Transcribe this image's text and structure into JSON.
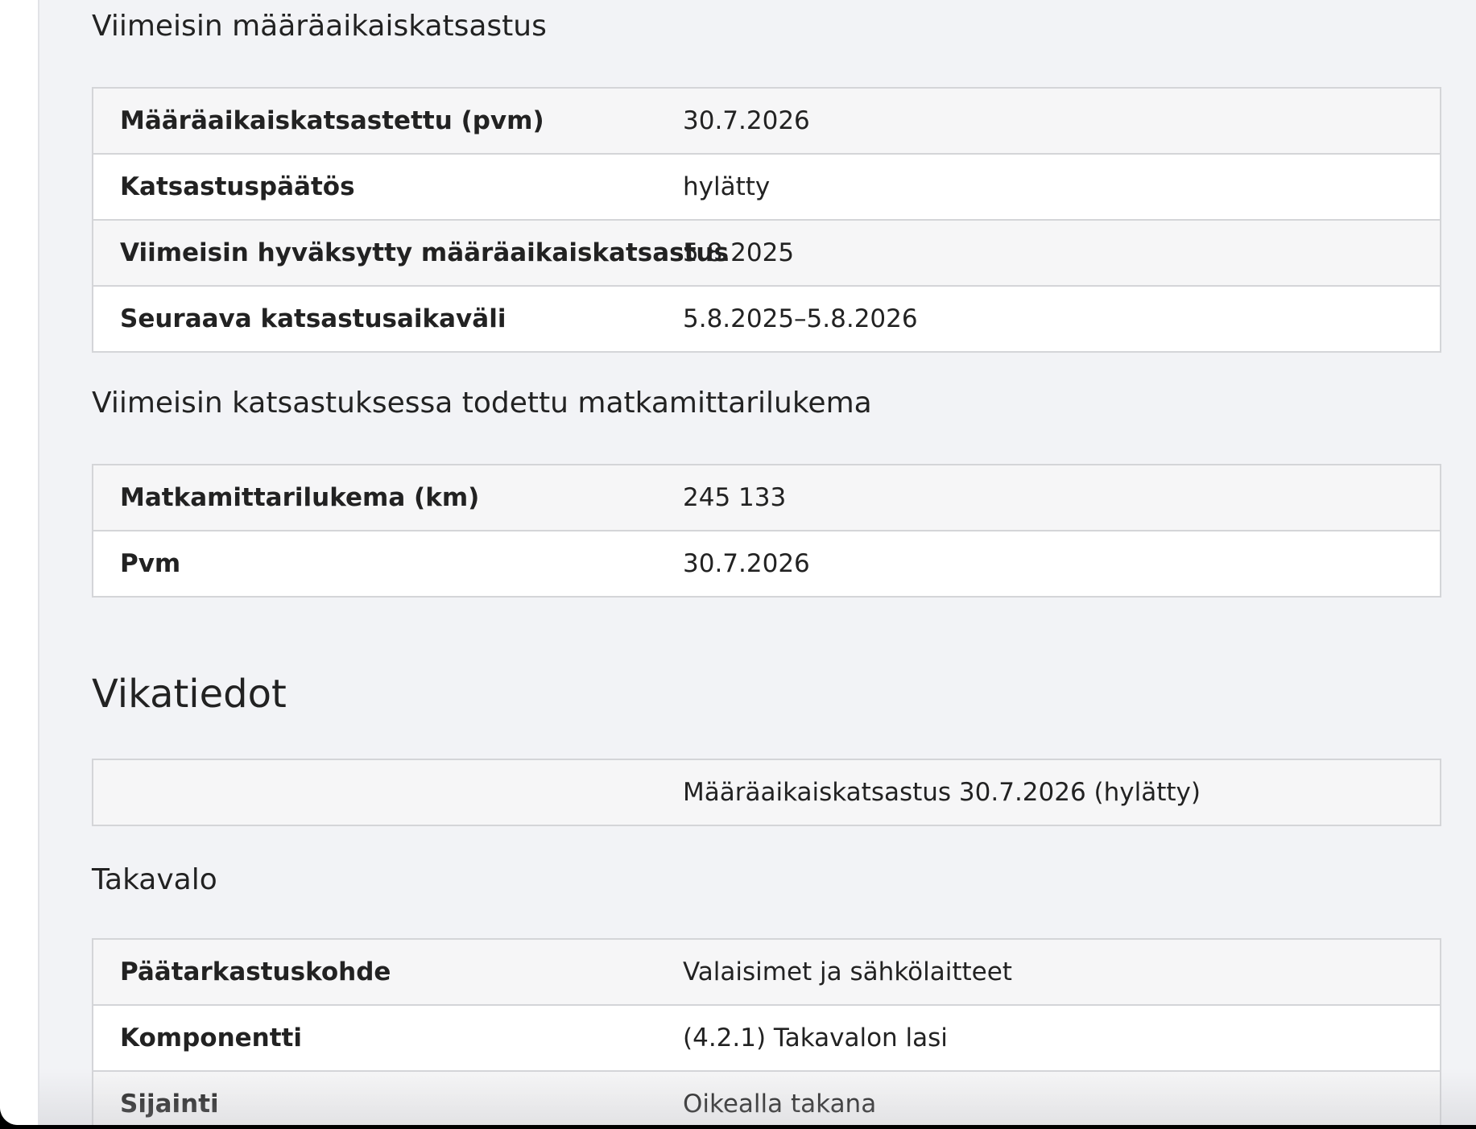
{
  "sections": {
    "inspection": {
      "title": "Viimeisin määräaikaiskatsastus",
      "rows": [
        {
          "label": "Määräaikaiskatsastettu (pvm)",
          "value": "30.7.2026"
        },
        {
          "label": "Katsastuspäätös",
          "value": "hylätty"
        },
        {
          "label": "Viimeisin hyväksytty määräaikaiskatsastus",
          "value": "5.8.2025"
        },
        {
          "label": "Seuraava katsastusaikaväli",
          "value": "5.8.2025–5.8.2026"
        }
      ]
    },
    "odometer": {
      "title": "Viimeisin katsastuksessa todettu matkamittarilukema",
      "rows": [
        {
          "label": "Matkamittarilukema (km)",
          "value": "245 133"
        },
        {
          "label": "Pvm",
          "value": "30.7.2026"
        }
      ]
    },
    "faults": {
      "title": "Vikatiedot",
      "summary_row": {
        "label": "",
        "value": "Määräaikaiskatsastus 30.7.2026 (hylätty)"
      },
      "item_title": "Takavalo",
      "rows": [
        {
          "label": "Päätarkastuskohde",
          "value": "Valaisimet ja sähkölaitteet"
        },
        {
          "label": "Komponentti",
          "value": "(4.2.1) Takavalon lasi"
        },
        {
          "label": "Sijainti",
          "value": "Oikealla takana"
        }
      ]
    }
  }
}
